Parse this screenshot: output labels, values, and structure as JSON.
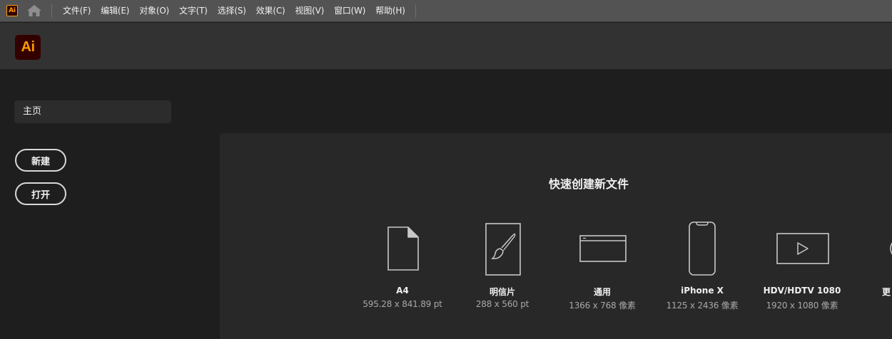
{
  "menubar": {
    "app_icon": "Ai",
    "home_icon": "home-icon",
    "items": [
      "文件(F)",
      "编辑(E)",
      "对象(O)",
      "文字(T)",
      "选择(S)",
      "效果(C)",
      "视图(V)",
      "窗口(W)",
      "帮助(H)"
    ]
  },
  "header": {
    "logo": "Ai"
  },
  "sidebar": {
    "home_label": "主页",
    "new_label": "新建",
    "open_label": "打开"
  },
  "main": {
    "title": "快速创建新文件",
    "presets": [
      {
        "name": "A4",
        "size": "595.28 x 841.89 pt",
        "icon": "document-icon"
      },
      {
        "name": "明信片",
        "size": "288 x 560 pt",
        "icon": "postcard-brush-icon"
      },
      {
        "name": "通用",
        "size": "1366 x 768 像素",
        "icon": "browser-window-icon"
      },
      {
        "name": "iPhone X",
        "size": "1125 x 2436 像素",
        "icon": "phone-icon"
      },
      {
        "name": "HDV/HDTV 1080",
        "size": "1920 x 1080 像素",
        "icon": "video-play-icon"
      },
      {
        "name": "更",
        "size": "",
        "icon": "more-icon"
      }
    ]
  },
  "colors": {
    "menubar_bg": "#535353",
    "header_bg": "#323232",
    "body_bg": "#1e1e1e",
    "panel_bg": "#282828",
    "ai_orange": "#ff9a00",
    "ai_dark": "#330000"
  }
}
